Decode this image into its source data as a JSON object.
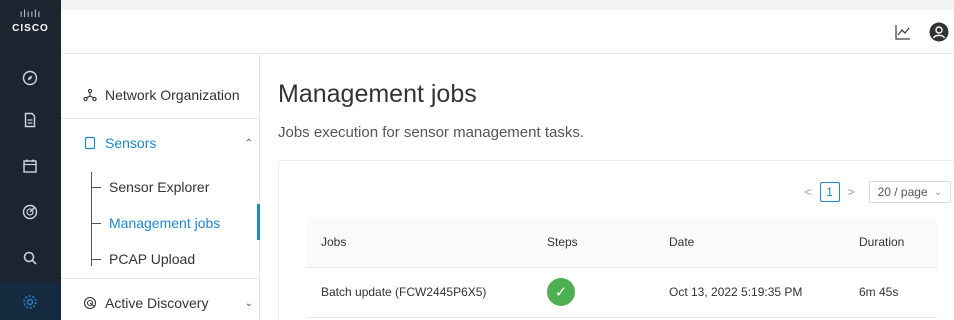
{
  "brand": {
    "bars": "ılıılı",
    "name": "CISCO"
  },
  "rail_icons": [
    "compass-icon",
    "document-icon",
    "calendar-icon",
    "radar-icon",
    "search-icon",
    "gear-icon"
  ],
  "top_icons": [
    "chart-icon",
    "user-icon"
  ],
  "sidenav": {
    "network_org": "Network Organization",
    "sensors": "Sensors",
    "sensor_explorer": "Sensor Explorer",
    "management_jobs": "Management jobs",
    "pcap_upload": "PCAP Upload",
    "active_discovery": "Active Discovery"
  },
  "main": {
    "title": "Management jobs",
    "subtitle": "Jobs execution for sensor management tasks."
  },
  "pager": {
    "prev": "<",
    "page": "1",
    "next": ">",
    "page_size": "20 / page"
  },
  "table": {
    "headers": [
      "Jobs",
      "Steps",
      "Date",
      "Duration"
    ],
    "rows": [
      {
        "job": "Batch update (FCW2445P6X5)",
        "steps": "✓",
        "date": "Oct 13, 2022 5:19:35 PM",
        "duration": "6m 45s"
      }
    ]
  },
  "colors": {
    "accent": "#1e88c9",
    "success": "#4caf50",
    "rail": "#1c2430"
  }
}
